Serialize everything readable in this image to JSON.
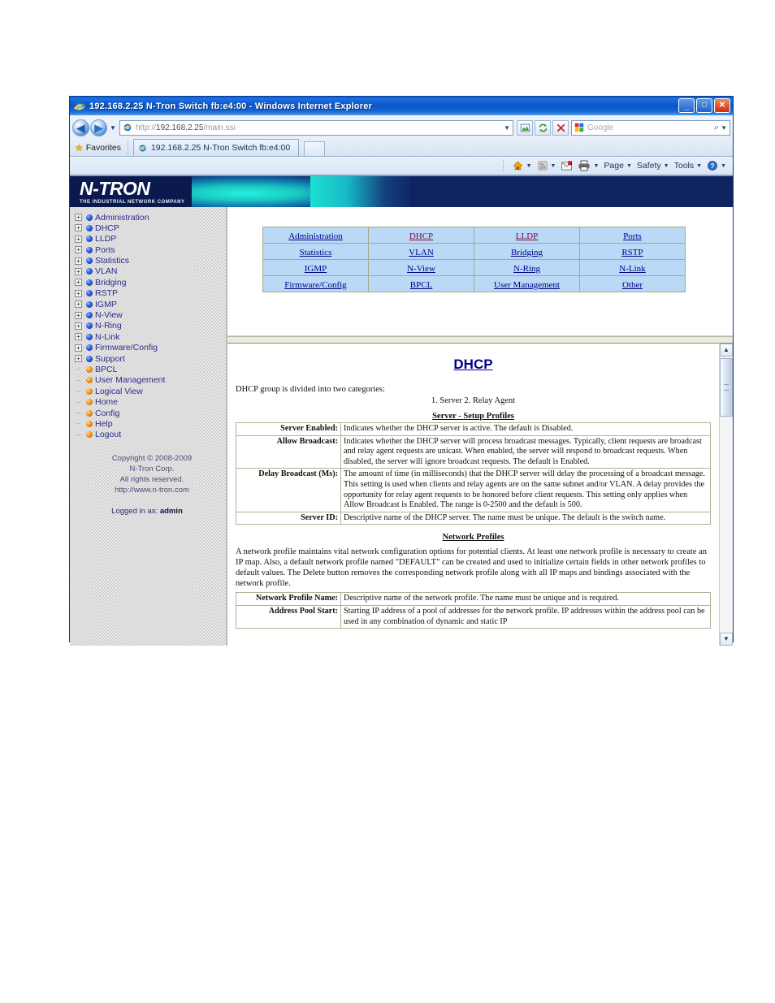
{
  "window": {
    "title": "192.168.2.25 N-Tron Switch fb:e4:00 - Windows Internet Explorer",
    "minimize_label": "_",
    "maximize_label": "□",
    "close_label": "✕"
  },
  "toolbar": {
    "back_label": "◀",
    "forward_label": "▶",
    "history_caret": "▼",
    "url_scheme": "http://",
    "url_host": "192.168.2.25",
    "url_path": "/main.ssi",
    "url_caret": "▼",
    "compat_icon": "compatibility-view-icon",
    "refresh_label": "↻",
    "stop_label": "✕",
    "search_placeholder": "Google",
    "search_go": "⌕",
    "search_caret": "▼"
  },
  "favorites": {
    "label": "Favorites",
    "star": "★"
  },
  "tab": {
    "title": "192.168.2.25 N-Tron Switch fb:e4:00"
  },
  "command_bar": {
    "home_caret": "▼",
    "feeds_caret": "▼",
    "mail_caret": "▼",
    "print_caret": "▼",
    "items": [
      {
        "label": "Page",
        "caret": "▼"
      },
      {
        "label": "Safety",
        "caret": "▼"
      },
      {
        "label": "Tools",
        "caret": "▼"
      },
      {
        "label": "",
        "caret": "▼"
      }
    ]
  },
  "banner": {
    "logo_main": "N-TRON",
    "logo_tagline": "THE INDUSTRIAL NETWORK COMPANY"
  },
  "sidebar": {
    "tree": [
      {
        "label": "Administration",
        "expandable": true
      },
      {
        "label": "DHCP",
        "expandable": true
      },
      {
        "label": "LLDP",
        "expandable": true
      },
      {
        "label": "Ports",
        "expandable": true
      },
      {
        "label": "Statistics",
        "expandable": true
      },
      {
        "label": "VLAN",
        "expandable": true
      },
      {
        "label": "Bridging",
        "expandable": true
      },
      {
        "label": "RSTP",
        "expandable": true
      },
      {
        "label": "IGMP",
        "expandable": true
      },
      {
        "label": "N-View",
        "expandable": true
      },
      {
        "label": "N-Ring",
        "expandable": true
      },
      {
        "label": "N-Link",
        "expandable": true
      },
      {
        "label": "Firmware/Config",
        "expandable": true
      },
      {
        "label": "Support",
        "expandable": true
      },
      {
        "label": "BPCL",
        "expandable": false
      },
      {
        "label": "User Management",
        "expandable": false
      },
      {
        "label": "Logical View",
        "expandable": false
      },
      {
        "label": "Home",
        "expandable": false
      },
      {
        "label": "Config",
        "expandable": false
      },
      {
        "label": "Help",
        "expandable": false
      },
      {
        "label": "Logout",
        "expandable": false
      }
    ],
    "expand_glyph": "+",
    "copyright_line1": "Copyright © 2008-2009",
    "copyright_line2": "N-Tron Corp.",
    "copyright_line3": "All rights reserved.",
    "copyright_line4": "http://www.n-tron.com",
    "logged_in_prefix": "Logged in as: ",
    "logged_in_user": "admin"
  },
  "nav_table": {
    "rows": [
      [
        {
          "label": "Administration",
          "visited": false
        },
        {
          "label": "DHCP",
          "visited": true
        },
        {
          "label": "LLDP",
          "visited": true
        },
        {
          "label": "Ports",
          "visited": false
        }
      ],
      [
        {
          "label": "Statistics",
          "visited": false
        },
        {
          "label": "VLAN",
          "visited": false
        },
        {
          "label": "Bridging",
          "visited": false
        },
        {
          "label": "RSTP",
          "visited": false
        }
      ],
      [
        {
          "label": "IGMP",
          "visited": false
        },
        {
          "label": "N-View",
          "visited": false
        },
        {
          "label": "N-Ring",
          "visited": false
        },
        {
          "label": "N-Link",
          "visited": false
        }
      ],
      [
        {
          "label": "Firmware/Config",
          "visited": false
        },
        {
          "label": "BPCL",
          "visited": false
        },
        {
          "label": "User Management",
          "visited": false
        },
        {
          "label": "Other",
          "visited": false
        }
      ]
    ]
  },
  "document": {
    "title": "DHCP",
    "intro": "DHCP group is divided into two categories:",
    "categories": "1. Server   2. Relay Agent",
    "server_section_heading": "Server - Setup Profiles",
    "server_rows": [
      {
        "key": "Server Enabled:",
        "value": "Indicates whether the DHCP server is active. The default is Disabled."
      },
      {
        "key": "Allow Broadcast:",
        "value": "Indicates whether the DHCP server will process broadcast messages. Typically, client requests are broadcast and relay agent requests are unicast. When enabled, the server will respond to broadcast requests. When disabled, the server will ignore broadcast requests. The default is Enabled."
      },
      {
        "key": "Delay Broadcast (Ms):",
        "value": "The amount of time (in milliseconds) that the DHCP server will delay the processing of a broadcast message. This setting is used when clients and relay agents are on the same subnet and/or VLAN. A delay provides the opportunity for relay agent requests to be honored before client requests. This setting only applies when Allow Broadcast is Enabled. The range is 0-2500 and the default is 500."
      },
      {
        "key": "Server ID:",
        "value": "Descriptive name of the DHCP server. The name must be unique. The default is the switch name."
      }
    ],
    "network_section_heading": "Network Profiles",
    "network_paragraph": "A network profile maintains vital network configuration options for potential clients. At least one network profile is necessary to create an IP map. Also, a default network profile named \"DEFAULT\" can be created and used to initialize certain fields in other network profiles to default values. The Delete button removes the corresponding network profile along with all IP maps and bindings associated with the network profile.",
    "network_rows": [
      {
        "key": "Network Profile Name:",
        "value": "Descriptive name of the network profile. The name must be unique and is required."
      },
      {
        "key": "Address Pool Start:",
        "value": "Starting IP address of a pool of addresses for the network profile. IP addresses within the address pool can be used in any combination of dynamic and static IP"
      }
    ]
  },
  "scrollbar": {
    "up_label": "▲",
    "down_label": "▼"
  }
}
